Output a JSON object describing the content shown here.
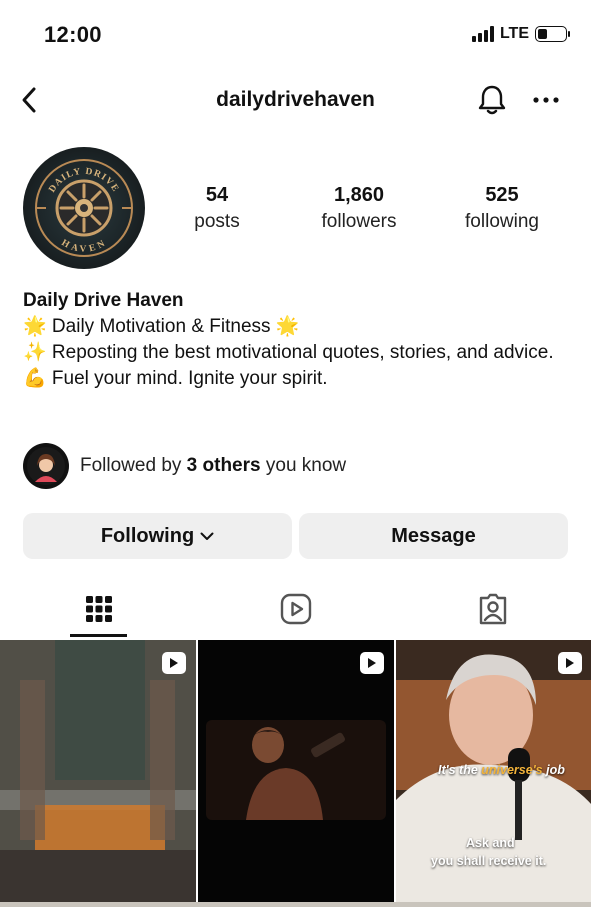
{
  "status_bar": {
    "time": "12:00",
    "network": "LTE"
  },
  "header": {
    "username": "dailydrivehaven"
  },
  "profile": {
    "avatar_text_top": "DAILY DRIVE",
    "avatar_text_bottom": "HAVEN",
    "stats": [
      {
        "value": "54",
        "label": "posts"
      },
      {
        "value": "1,860",
        "label": "followers"
      },
      {
        "value": "525",
        "label": "following"
      }
    ],
    "display_name": "Daily Drive Haven",
    "bio_lines": [
      "🌟 Daily Motivation & Fitness 🌟",
      "✨ Reposting the best motivational quotes, stories, and advice.",
      "💪 Fuel your mind. Ignite your spirit."
    ],
    "followed_by": {
      "prefix": "Followed by",
      "bold": "3 others",
      "suffix": "you know"
    }
  },
  "actions": {
    "following_label": "Following",
    "message_label": "Message"
  },
  "tabs": [
    {
      "icon": "grid-icon",
      "active": true
    },
    {
      "icon": "reels-icon",
      "active": false
    },
    {
      "icon": "tagged-icon",
      "active": false
    }
  ],
  "grid": [
    {
      "type": "reel",
      "captions": []
    },
    {
      "type": "reel",
      "captions": []
    },
    {
      "type": "reel",
      "captions": [
        "It's the",
        "universe's",
        "job",
        "Ask and",
        "you shall receive it."
      ]
    }
  ],
  "colors": {
    "button_bg": "#efefef",
    "highlight": "#f2b33a",
    "text": "#111111"
  }
}
